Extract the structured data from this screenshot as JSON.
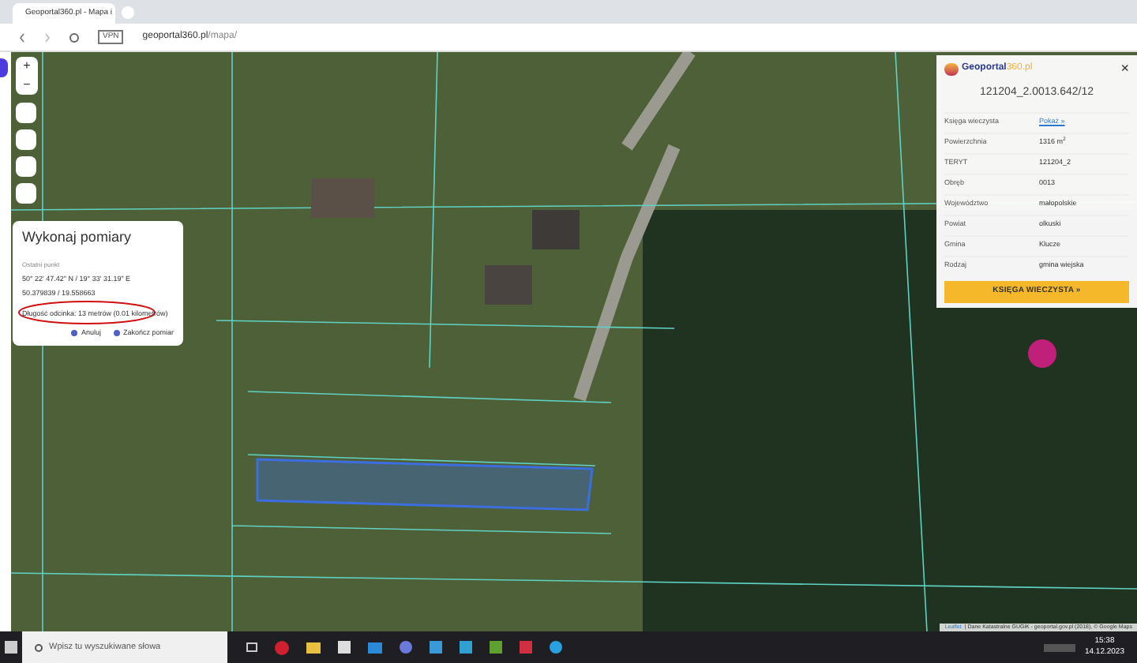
{
  "browser": {
    "tab_title": "Geoportal360.pl - Mapa i",
    "vpn": "VPN",
    "url_host": "geoportal360.pl",
    "url_path": "/mapa/"
  },
  "measure_panel": {
    "title": "Wykonaj pomiary",
    "last_point_label": "Ostatni punkt",
    "dms": "50° 22' 47.42\" N / 19° 33' 31.19\" E",
    "decimal": "50.379839 / 19.558663",
    "length": "Długość odcinka: 13 metrów (0.01 kilometrów)",
    "buttons": [
      "Anuluj",
      "Zakończ pomiar"
    ]
  },
  "parcel_panel": {
    "logo_text": "Geoportal",
    "logo_suffix": "360.pl",
    "close": "×",
    "parcel_id": "121204_2.0013.642/12",
    "rows": [
      {
        "label": "Księga wieczysta",
        "value": "Pokaż »",
        "kind": "link"
      },
      {
        "label": "Powierzchnia",
        "value": "1316 m$^{2}$",
        "kind": "text"
      },
      {
        "label": "TERYT",
        "value": "121204_2",
        "kind": "text"
      },
      {
        "label": "Obręb",
        "value": "0013",
        "kind": "text"
      },
      {
        "label": "Województwo",
        "value": "małopolskie",
        "kind": "text"
      },
      {
        "label": "Powiat",
        "value": "olkuski",
        "kind": "text"
      },
      {
        "label": "Gmina",
        "value": "Klucze",
        "kind": "text"
      },
      {
        "label": "Rodzaj",
        "value": "gmina wiejska",
        "kind": "text"
      }
    ],
    "button": "KSIĘGA WIECZYSTA »"
  },
  "map_controls": [
    "+",
    "−"
  ],
  "attribution": {
    "leaflet": "Leaflet",
    "rest": "| Dane Katastralne GUGiK - geoportal.gov.pl (2018), © Google Maps"
  },
  "taskbar": {
    "search_placeholder": "Wpisz tu wyszukiwane słowa",
    "time": "15:38",
    "date": "14.12.2023"
  }
}
